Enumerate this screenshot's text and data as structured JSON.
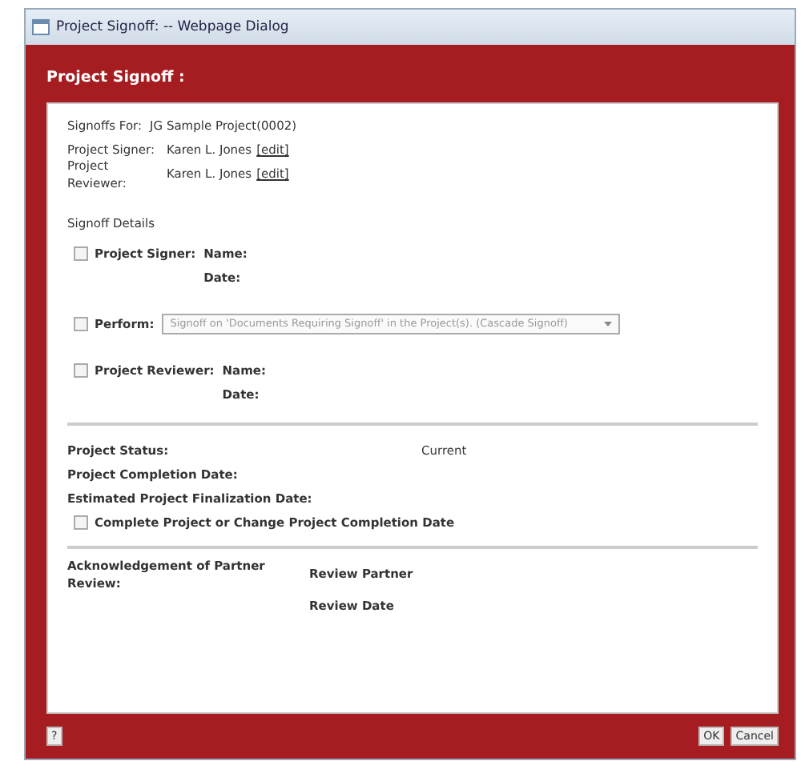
{
  "window": {
    "title": "Project Signoff: -- Webpage Dialog"
  },
  "header": "Project Signoff :",
  "info": [
    {
      "label": "Signoffs For:",
      "value": "JG Sample Project(0002)"
    },
    {
      "label": "Project Signer:",
      "value": "Karen L. Jones",
      "link": "[edit]"
    },
    {
      "label": "Project Reviewer:",
      "value": "Karen L. Jones",
      "link": "[edit]"
    }
  ],
  "signoff_details": {
    "title": "Signoff Details",
    "rows": [
      {
        "kind": "person",
        "label": "Project Signer:",
        "checked": false,
        "name_label": "Name:",
        "date_label": "Date:"
      },
      {
        "kind": "select",
        "label": "Perform:",
        "checked": false,
        "value": "Signoff on 'Documents Requiring Signoff' in the Project(s). (Cascade Signoff)",
        "disabled": true
      },
      {
        "kind": "person",
        "label": "Project Reviewer:",
        "checked": false,
        "name_label": "Name:",
        "date_label": "Date:"
      }
    ]
  },
  "status": {
    "fields": [
      {
        "label": "Project Status:",
        "value": "Current"
      },
      {
        "label": "Project Completion Date:"
      },
      {
        "label": "Estimated Project Finalization Date:"
      }
    ],
    "checkbox": {
      "label": "Complete Project or Change Project Completion Date",
      "checked": false
    }
  },
  "acknowledgement": {
    "label": "Acknowledgement of Partner Review:",
    "lines": [
      "Review Partner",
      "Review Date"
    ]
  },
  "footer": {
    "help": "?",
    "buttons": [
      "OK",
      "Cancel"
    ]
  }
}
